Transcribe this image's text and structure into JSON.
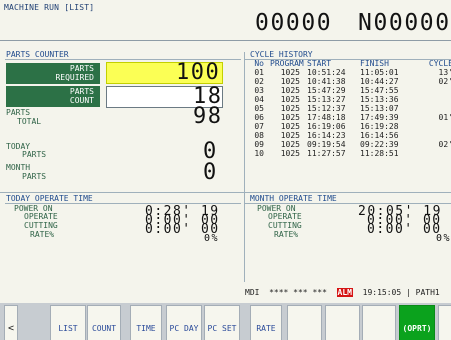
{
  "title": "MACHINE RUN  [LIST]",
  "header_numbers": [
    "00000",
    "N00000"
  ],
  "parts_counter": {
    "heading": "PARTS COUNTER",
    "required_label_1": "PARTS",
    "required_label_2": "REQUIRED",
    "count_label_1": "PARTS",
    "count_label_2": "COUNT",
    "total_label_1": "PARTS",
    "total_label_2": "TOTAL",
    "today_label_1": "TODAY",
    "today_label_2": "PARTS",
    "month_label_1": "MONTH",
    "month_label_2": "PARTS",
    "parts_required": "100",
    "parts_count": "18",
    "parts_total": "98",
    "today_parts": "0",
    "month_parts": "0"
  },
  "cycle_history": {
    "heading": "CYCLE HISTORY",
    "columns": [
      "No",
      "PROGRAM",
      "START",
      "FINISH",
      "CYCLE"
    ],
    "rows": [
      {
        "no": "01",
        "program": "1025",
        "start": "10:51:24",
        "finish": "11:05:01",
        "cycle": "13'"
      },
      {
        "no": "02",
        "program": "1025",
        "start": "10:41:38",
        "finish": "10:44:27",
        "cycle": "02'"
      },
      {
        "no": "03",
        "program": "1025",
        "start": "15:47:29",
        "finish": "15:47:55",
        "cycle": ""
      },
      {
        "no": "04",
        "program": "1025",
        "start": "15:13:27",
        "finish": "15:13:36",
        "cycle": ""
      },
      {
        "no": "05",
        "program": "1025",
        "start": "15:12:37",
        "finish": "15:13:07",
        "cycle": ""
      },
      {
        "no": "06",
        "program": "1025",
        "start": "17:48:18",
        "finish": "17:49:39",
        "cycle": "01'"
      },
      {
        "no": "07",
        "program": "1025",
        "start": "16:19:06",
        "finish": "16:19:28",
        "cycle": ""
      },
      {
        "no": "08",
        "program": "1025",
        "start": "16:14:23",
        "finish": "16:14:56",
        "cycle": ""
      },
      {
        "no": "09",
        "program": "1025",
        "start": "09:19:54",
        "finish": "09:22:39",
        "cycle": "02'"
      },
      {
        "no": "10",
        "program": "1025",
        "start": "11:27:57",
        "finish": "11:28:51",
        "cycle": ""
      }
    ]
  },
  "today_operate": {
    "heading": "TODAY OPERATE TIME",
    "labels": [
      "POWER ON",
      "OPERATE",
      "CUTTING",
      "RATE%"
    ],
    "values": [
      "0:28' 19",
      "0:00' 00",
      "0:00' 00",
      "0%"
    ]
  },
  "month_operate": {
    "heading": "MONTH OPERATE TIME",
    "labels": [
      "POWER ON",
      "OPERATE",
      "CUTTING",
      "RATE%"
    ],
    "values": [
      "20:05' 19",
      "0:00' 00",
      "0:00' 00",
      "0%"
    ]
  },
  "status_bar": {
    "mode": "MDI",
    "stars": "**** *** ***",
    "alarm": "ALM",
    "time": "19:15:05",
    "path": "PATH1"
  },
  "softkeys": [
    "<",
    "LIST",
    "COUNT",
    "TIME",
    "PC DAY",
    "PC SET",
    "RATE",
    "",
    "",
    "",
    "(OPRT)",
    ""
  ],
  "colors": {
    "screen_bg": "#f4f4ec",
    "highlight": "#fbff55",
    "green": "#2c7146",
    "alarm": "#d51414",
    "active_key": "#0ba21d"
  }
}
